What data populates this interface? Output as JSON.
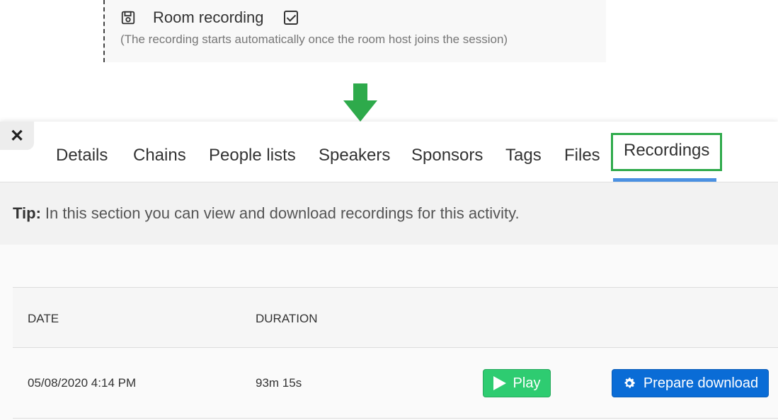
{
  "room_recording": {
    "label": "Room recording",
    "note": "(The recording starts automatically once the room host joins the session)",
    "checked": true
  },
  "panel": {
    "close_symbol": "✕",
    "tabs": [
      {
        "label": "Details"
      },
      {
        "label": "Chains"
      },
      {
        "label": "People lists"
      },
      {
        "label": "Speakers"
      },
      {
        "label": "Sponsors"
      },
      {
        "label": "Tags"
      },
      {
        "label": "Files"
      },
      {
        "label": "Recordings"
      }
    ],
    "tip_label": "Tip:",
    "tip_text": "In this section you can view and download recordings for this activity.",
    "table": {
      "headers": [
        "DATE",
        "DURATION"
      ],
      "rows": [
        {
          "date": "05/08/2020 4:14 PM",
          "duration": "93m 15s",
          "play_label": "Play",
          "download_label": "Prepare download"
        }
      ]
    }
  },
  "colors": {
    "highlight_green": "#2eaa4b",
    "tab_underline": "#4a90e2",
    "play_button": "#2ecc71",
    "download_button": "#0a6cd6"
  }
}
